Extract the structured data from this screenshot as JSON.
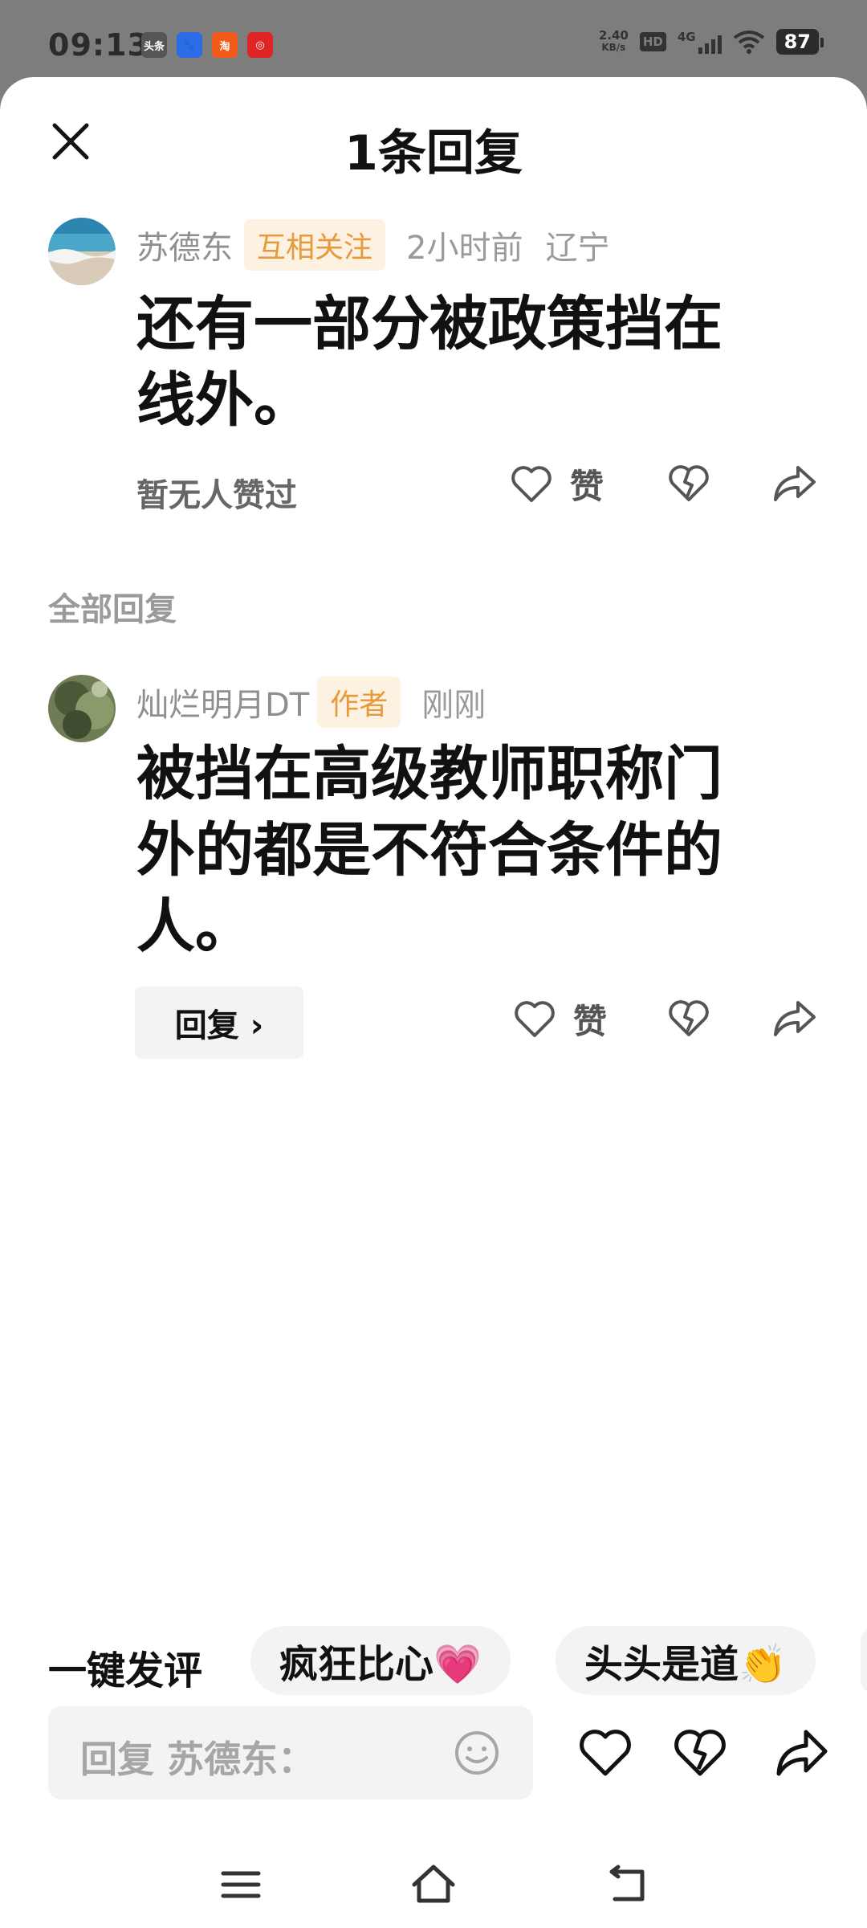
{
  "status_bar": {
    "time": "09:13",
    "apps": [
      {
        "icon": "toutiao-icon",
        "text": "头条",
        "color": "#555555"
      },
      {
        "icon": "baidu-icon",
        "text": "🐾",
        "color": "#2e6be6"
      },
      {
        "icon": "taobao-icon",
        "text": "淘",
        "color": "#f25a16"
      },
      {
        "icon": "app-red-icon",
        "text": "◎",
        "color": "#e02424"
      }
    ],
    "net_speed_value": "2.40",
    "net_speed_unit": "KB/s",
    "hd": "HD",
    "signal": "4G",
    "battery": "87"
  },
  "header": {
    "title": "1条回复"
  },
  "main_comment": {
    "user": "苏德东",
    "tag": "互相关注",
    "time": "2小时前",
    "location": "辽宁",
    "text": "还有一部分被政策挡在线外。",
    "likes_info": "暂无人赞过",
    "like_label": "赞"
  },
  "section_label": "全部回复",
  "reply": {
    "user": "灿烂明月DT",
    "tag": "作者",
    "time": "刚刚",
    "text": "被挡在高级教师职称门外的都是不符合条件的人。",
    "reply_button": "回复 ›",
    "like_label": "赞"
  },
  "quick_comment": {
    "label": "一键发评",
    "chips": [
      "疯狂比心💗",
      "头头是道👏"
    ]
  },
  "reply_input": {
    "placeholder": "回复 苏德东："
  },
  "colors": {
    "tag_bg": "#fdf1e2",
    "tag_text": "#e79a3b",
    "overlay": "#7d7d7d"
  }
}
